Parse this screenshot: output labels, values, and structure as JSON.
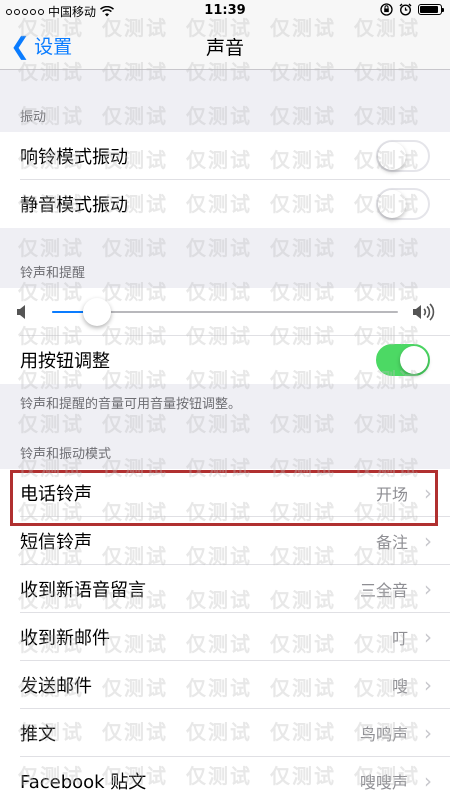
{
  "status_bar": {
    "carrier": "中国移动",
    "time": "11:39"
  },
  "nav": {
    "back_label": "设置",
    "title": "声音"
  },
  "vibration": {
    "header": "振动",
    "rows": [
      {
        "label": "响铃模式振动",
        "on": false
      },
      {
        "label": "静音模式振动",
        "on": false
      }
    ]
  },
  "ringer": {
    "header": "铃声和提醒",
    "volume_level": 0.13,
    "buttons_row": {
      "label": "用按钮调整",
      "on": true
    },
    "footnote": "铃声和提醒的音量可用音量按钮调整。"
  },
  "sounds": {
    "header": "铃声和振动模式",
    "rows": [
      {
        "label": "电话铃声",
        "value": "开场"
      },
      {
        "label": "短信铃声",
        "value": "备注"
      },
      {
        "label": "收到新语音留言",
        "value": "三全音"
      },
      {
        "label": "收到新邮件",
        "value": "叮"
      },
      {
        "label": "发送邮件",
        "value": "嗖"
      },
      {
        "label": "推文",
        "value": "鸟鸣声"
      },
      {
        "label": "Facebook 贴文",
        "value": "嗖嗖声"
      }
    ]
  },
  "watermark_text": "仅测试",
  "colors": {
    "accent": "#0a7cff",
    "toggle_on": "#4cd964",
    "highlight_box": "#b03030"
  }
}
